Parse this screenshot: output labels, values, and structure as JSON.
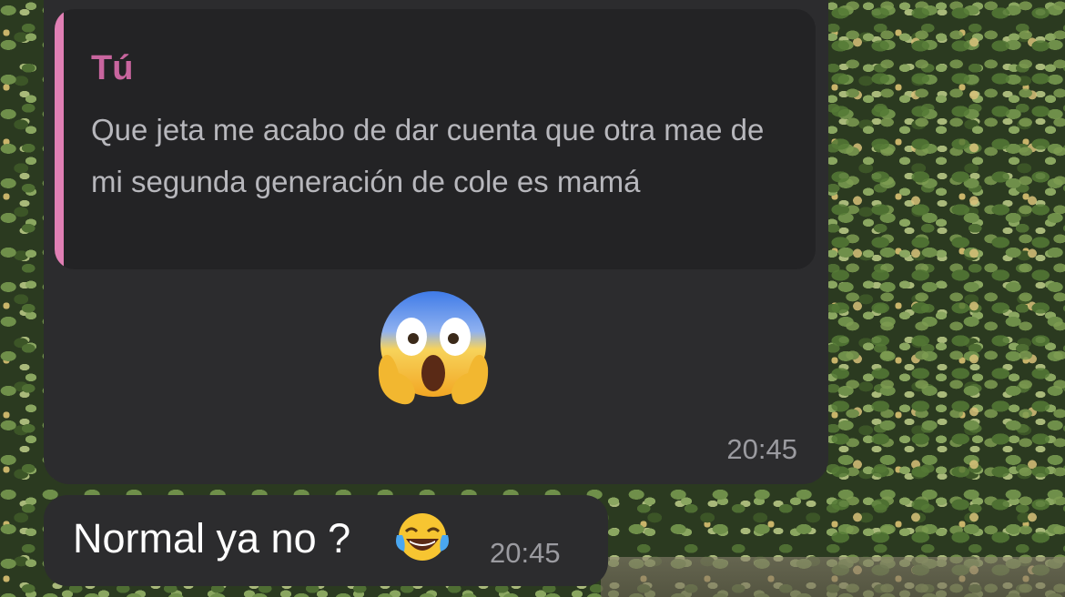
{
  "chat": {
    "messages": [
      {
        "reply_to": {
          "sender": "Tú",
          "text": "Que jeta me acabo de dar cuenta que otra mae de mi segunda generación de cole es mamá"
        },
        "emoji": "face-screaming-in-fear-emoji",
        "time": "20:45"
      },
      {
        "text": "Normal ya no ?",
        "emoji": "face-with-tears-of-joy-emoji",
        "time": "20:45"
      }
    ]
  },
  "colors": {
    "bubble_bg": "#2c2c2e",
    "quote_bg": "#232325",
    "quote_accent": "#e07fb4",
    "quote_name": "#c8659e",
    "timestamp": "#9b9ba0"
  }
}
